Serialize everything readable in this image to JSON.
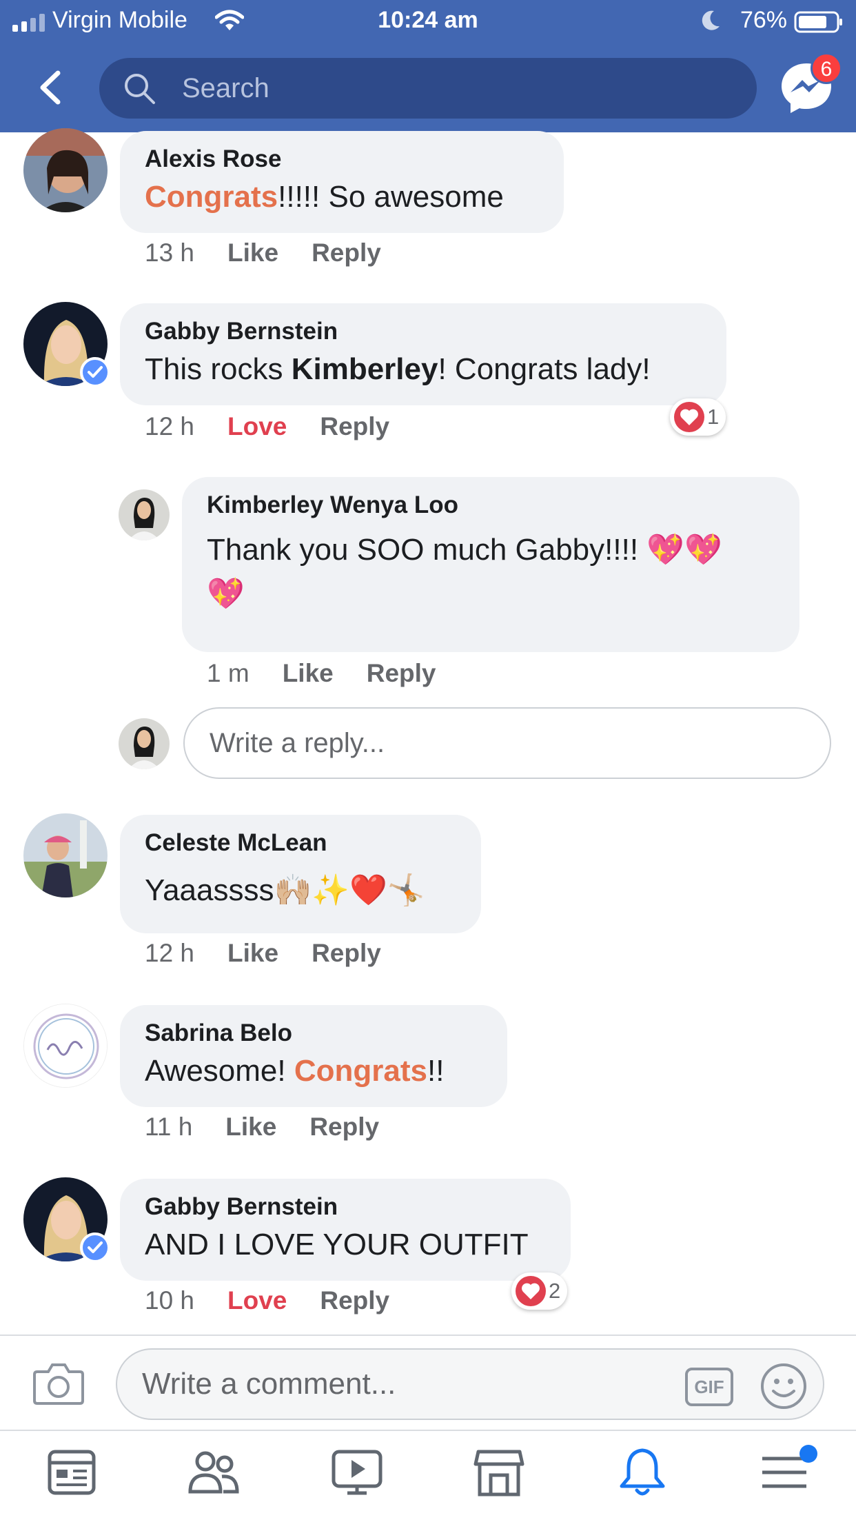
{
  "status_bar": {
    "carrier": "Virgin Mobile",
    "time": "10:24 am",
    "battery": "76%"
  },
  "nav": {
    "search_placeholder": "Search",
    "messenger_badge": "6"
  },
  "comments": [
    {
      "author": "Alexis Rose",
      "text_parts": [
        "Congrats",
        "!!!!! So awesome"
      ],
      "time": "13 h",
      "like_label": "Like",
      "reply_label": "Reply"
    },
    {
      "author": "Gabby Bernstein",
      "text_parts": [
        "This rocks ",
        "Kimberley",
        "! Congrats lady!"
      ],
      "time": "12 h",
      "like_label": "Love",
      "reply_label": "Reply",
      "reaction_count": "1"
    },
    {
      "author": "Celeste McLean",
      "text": "Yaaassss",
      "emoji": "🙌🏼✨❤️🤸🏼",
      "time": "12 h",
      "like_label": "Like",
      "reply_label": "Reply"
    },
    {
      "author": "Sabrina Belo",
      "text_parts": [
        "Awesome!  ",
        "Congrats",
        "!!"
      ],
      "time": "11 h",
      "like_label": "Like",
      "reply_label": "Reply"
    },
    {
      "author": "Gabby Bernstein",
      "text": "AND I LOVE YOUR OUTFIT",
      "time": "10 h",
      "like_label": "Love",
      "reply_label": "Reply",
      "reaction_count": "2"
    }
  ],
  "reply": {
    "author": "Kimberley Wenya Loo",
    "text": "Thank you SOO much Gabby!!!! ",
    "emoji_line1": "💖💖",
    "emoji_line2": "💖",
    "time": "1 m",
    "like_label": "Like",
    "reply_label": "Reply"
  },
  "reply_input": {
    "placeholder": "Write a reply..."
  },
  "composer": {
    "placeholder": "Write a comment...",
    "gif_label": "GIF"
  },
  "colors": {
    "header": "#4267b2",
    "highlight": "#e4714c",
    "love": "#e0404f",
    "bubble": "#f0f2f5",
    "active_tab": "#1877f2"
  },
  "tabs": [
    "news-feed-icon",
    "friends-icon",
    "watch-icon",
    "marketplace-icon",
    "notifications-icon",
    "menu-icon"
  ]
}
